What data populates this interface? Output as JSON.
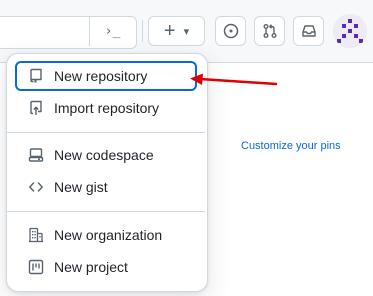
{
  "header": {
    "command_glyph": "›_",
    "create_plus": "+",
    "create_caret": "▾"
  },
  "dropdown": {
    "group1": [
      {
        "label": "New repository",
        "icon": "repo-icon"
      },
      {
        "label": "Import repository",
        "icon": "repo-push-icon"
      }
    ],
    "group2": [
      {
        "label": "New codespace",
        "icon": "codespaces-icon"
      },
      {
        "label": "New gist",
        "icon": "code-icon"
      }
    ],
    "group3": [
      {
        "label": "New organization",
        "icon": "organization-icon"
      },
      {
        "label": "New project",
        "icon": "project-icon"
      }
    ]
  },
  "pins": {
    "customize_label": "Customize your pins"
  },
  "colors": {
    "accent": "#0969da",
    "annotation": "#e00000",
    "text": "#1f2328",
    "muted": "#59636e",
    "border": "#d1d9e0"
  }
}
